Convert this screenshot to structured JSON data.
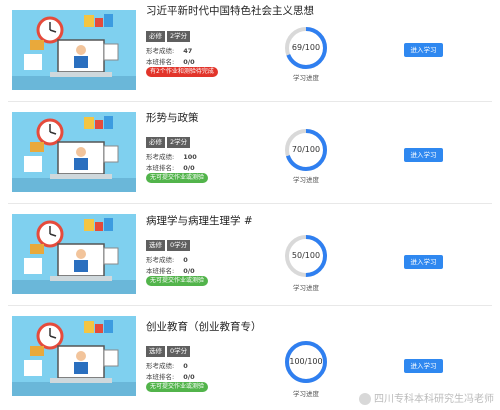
{
  "courses": [
    {
      "title": "习近平新时代中国特色社会主义思想",
      "type_tag": "必修",
      "credit_tag": "2学分",
      "exam_label": "形考成绩:",
      "exam_value": "47",
      "final_label": "本班排名:",
      "final_value": "0/0",
      "status": "有2个作业和测验待完成",
      "status_kind": "red",
      "progress_text": "69/100",
      "progress": 0.69,
      "progress_caption": "学习进度",
      "button": "进入学习"
    },
    {
      "title": "形势与政策",
      "type_tag": "必修",
      "credit_tag": "2学分",
      "exam_label": "形考成绩:",
      "exam_value": "100",
      "final_label": "本班排名:",
      "final_value": "0/0",
      "status": "无可提交作业或测验",
      "status_kind": "green",
      "progress_text": "70/100",
      "progress": 0.7,
      "progress_caption": "学习进度",
      "button": "进入学习"
    },
    {
      "title": "病理学与病理生理学 #",
      "type_tag": "选修",
      "credit_tag": "0学分",
      "exam_label": "形考成绩:",
      "exam_value": "0",
      "final_label": "本班排名:",
      "final_value": "0/0",
      "status": "无可提交作业或测验",
      "status_kind": "green",
      "progress_text": "50/100",
      "progress": 0.5,
      "progress_caption": "学习进度",
      "button": "进入学习"
    },
    {
      "title": "创业教育（创业教育专）",
      "type_tag": "选修",
      "credit_tag": "0学分",
      "exam_label": "形考成绩:",
      "exam_value": "0",
      "final_label": "本班排名:",
      "final_value": "0/0",
      "status": "无可提交作业或测验",
      "status_kind": "green",
      "progress_text": "100/100",
      "progress": 1.0,
      "progress_caption": "学习进度",
      "button": "进入学习"
    }
  ],
  "colors": {
    "ring_fill": "#2f7ff0",
    "ring_track": "#d9d9d9",
    "button": "#2f88f0",
    "status_red": "#e2342a",
    "status_green": "#52b44b"
  },
  "watermark": "四川专科本科研究生冯老师"
}
